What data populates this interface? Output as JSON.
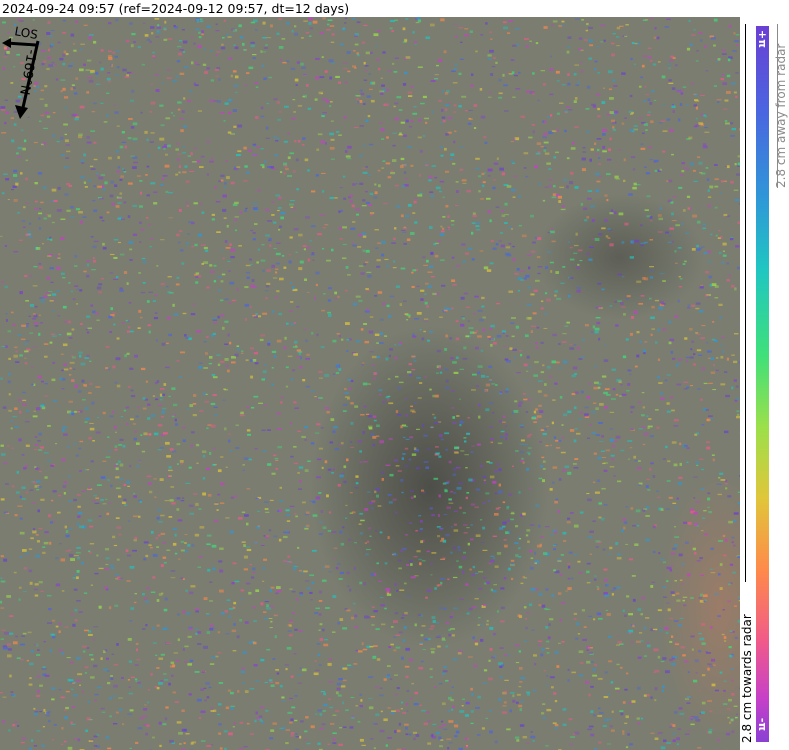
{
  "title": "2024-09-24 09:57 (ref=2024-09-12 09:57, dt=12 days)",
  "map": {
    "north_arrow": {
      "los_label": "LOS",
      "north_label": "-169°N"
    }
  },
  "colorbar": {
    "top_label": "+π",
    "bottom_label": "-π",
    "away_text": "2.8 cm away from radar",
    "towards_text": "2.8 cm towards radar",
    "colors": [
      "#6b3fd4",
      "#4a66e0",
      "#2f97d8",
      "#1fc6c2",
      "#3fe07a",
      "#9be04a",
      "#e0c63a",
      "#ff8a4a",
      "#f05a8a",
      "#c640c8",
      "#8a40d4"
    ]
  }
}
